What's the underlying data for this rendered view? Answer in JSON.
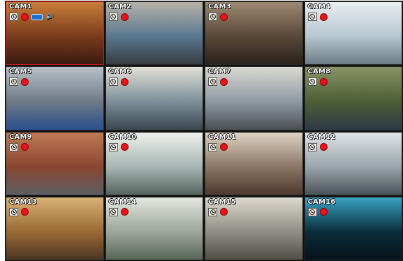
{
  "cameras": [
    {
      "label": "CAM1",
      "colors": [
        "#7a3b1c",
        "#c97f3a",
        "#3a1a10"
      ],
      "overlay": [
        "clock-icon",
        "record-indicator",
        "motion-icon",
        "audio-icon"
      ]
    },
    {
      "label": "CAM2",
      "colors": [
        "#5a7891",
        "#b6b3a8",
        "#383c42"
      ],
      "overlay": [
        "clock-icon",
        "record-indicator"
      ]
    },
    {
      "label": "CAM3",
      "colors": [
        "#5a4838",
        "#9e8a72",
        "#2a221c"
      ],
      "overlay": [
        "clock-icon",
        "record-indicator"
      ]
    },
    {
      "label": "CAM4",
      "colors": [
        "#b7c7cf",
        "#e9eef1",
        "#6b7c86"
      ],
      "overlay": [
        "clock-icon",
        "record-indicator"
      ]
    },
    {
      "label": "CAM5",
      "colors": [
        "#6e7a86",
        "#b8c1c9",
        "#2c4f8f"
      ],
      "overlay": [
        "clock-icon",
        "record-indicator"
      ]
    },
    {
      "label": "CAM6",
      "colors": [
        "#7c8f9a",
        "#e2e0d8",
        "#3a4650"
      ],
      "overlay": [
        "clock-icon",
        "record-indicator"
      ]
    },
    {
      "label": "CAM7",
      "colors": [
        "#8f9aa3",
        "#dad8d2",
        "#4a4e52"
      ],
      "overlay": [
        "clock-icon",
        "record-indicator"
      ]
    },
    {
      "label": "CAM8",
      "colors": [
        "#4d5e36",
        "#8a9366",
        "#2d3a46"
      ],
      "overlay": [
        "clock-icon",
        "record-indicator"
      ]
    },
    {
      "label": "CAM9",
      "colors": [
        "#8a4630",
        "#c07a57",
        "#5b5f64"
      ],
      "overlay": [
        "clock-icon",
        "record-indicator"
      ]
    },
    {
      "label": "CAM10",
      "colors": [
        "#a8b6b3",
        "#eef0ec",
        "#56645f"
      ],
      "overlay": [
        "clock-icon",
        "record-indicator"
      ]
    },
    {
      "label": "CAM11",
      "colors": [
        "#8c7766",
        "#ded3c3",
        "#4c3a2e"
      ],
      "overlay": [
        "clock-icon",
        "record-indicator"
      ]
    },
    {
      "label": "CAM12",
      "colors": [
        "#9aa5ab",
        "#dfe5e8",
        "#4a5358"
      ],
      "overlay": [
        "clock-icon",
        "record-indicator"
      ]
    },
    {
      "label": "CAM13",
      "colors": [
        "#9b6a36",
        "#d8b175",
        "#4a3522"
      ],
      "overlay": [
        "clock-icon",
        "record-indicator"
      ]
    },
    {
      "label": "CAM14",
      "colors": [
        "#9ca69a",
        "#e4e7e0",
        "#5b665a"
      ],
      "overlay": [
        "clock-icon",
        "record-indicator"
      ]
    },
    {
      "label": "CAM15",
      "colors": [
        "#8f8d86",
        "#ddd9cf",
        "#514e47"
      ],
      "overlay": [
        "clock-icon",
        "record-indicator"
      ]
    },
    {
      "label": "CAM16",
      "colors": [
        "#0b2d3b",
        "#39a3c3",
        "#051219"
      ],
      "overlay": [
        "clock-icon",
        "record-indicator"
      ]
    }
  ],
  "selected_camera": "CAM1"
}
